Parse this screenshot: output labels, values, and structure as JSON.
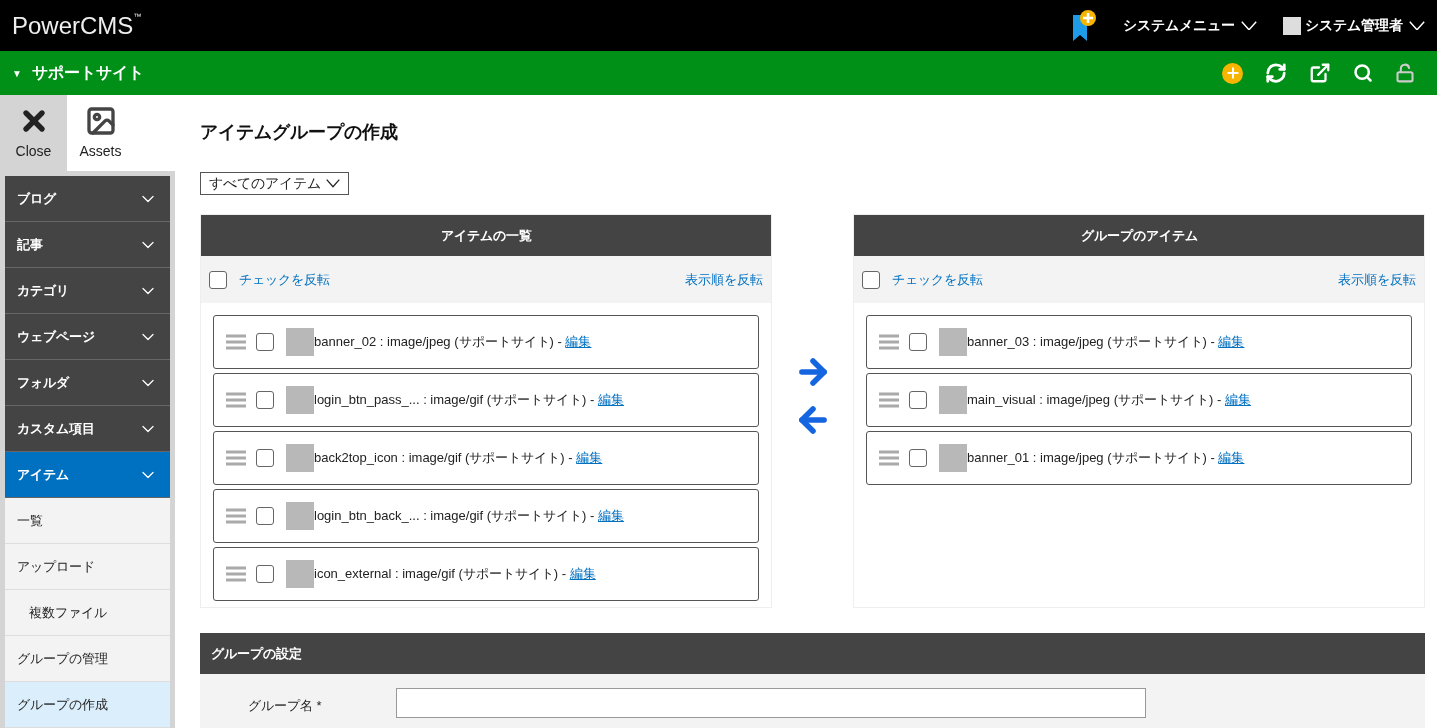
{
  "header": {
    "logo": "PowerCMS",
    "trademark": "™",
    "system_menu": "システムメニュー",
    "user": "システム管理者"
  },
  "site_bar": {
    "caret": "▼",
    "site_name": "サポートサイト"
  },
  "side_tools": [
    {
      "label": "Close",
      "kind": "close",
      "selected": true
    },
    {
      "label": "Assets",
      "kind": "assets",
      "selected": false
    }
  ],
  "sidebar": {
    "sections": [
      {
        "label": "ブログ",
        "selected": false
      },
      {
        "label": "記事",
        "selected": false
      },
      {
        "label": "カテゴリ",
        "selected": false
      },
      {
        "label": "ウェブページ",
        "selected": false
      },
      {
        "label": "フォルダ",
        "selected": false
      },
      {
        "label": "カスタム項目",
        "selected": false
      },
      {
        "label": "アイテム",
        "selected": true
      }
    ],
    "items": [
      {
        "label": "一覧",
        "selected": false
      },
      {
        "label": "アップロード",
        "selected": false,
        "children": [
          {
            "label": "複数ファイル",
            "selected": false
          }
        ]
      },
      {
        "label": "グループの管理",
        "selected": false
      },
      {
        "label": "グループの作成",
        "selected": true
      }
    ]
  },
  "page_title": "アイテムグループの作成",
  "filter": {
    "value": "すべてのアイテム"
  },
  "panels": [
    {
      "title": "アイテムの一覧",
      "invert_check": "チェックを反転",
      "reverse_order": "表示順を反転",
      "select_all": false,
      "items": [
        {
          "text": "banner_02 : image/jpeg (サポートサイト) - ",
          "link": "編集",
          "checked": false
        },
        {
          "text": "login_btn_pass_... : image/gif (サポートサイト) - ",
          "link": "編集",
          "checked": false
        },
        {
          "text": "back2top_icon : image/gif (サポートサイト) - ",
          "link": "編集",
          "checked": false
        },
        {
          "text": "login_btn_back_... : image/gif (サポートサイト) - ",
          "link": "編集",
          "checked": false
        },
        {
          "text": "icon_external : image/gif (サポートサイト) - ",
          "link": "編集",
          "checked": false
        }
      ]
    },
    {
      "title": "グループのアイテム",
      "invert_check": "チェックを反転",
      "reverse_order": "表示順を反転",
      "select_all": false,
      "items": [
        {
          "text": "banner_03 : image/jpeg (サポートサイト) - ",
          "link": "編集",
          "checked": false
        },
        {
          "text": "main_visual : image/jpeg (サポートサイト) - ",
          "link": "編集",
          "checked": false
        },
        {
          "text": "banner_01 : image/jpeg (サポートサイト) - ",
          "link": "編集",
          "checked": false
        }
      ]
    }
  ],
  "settings": {
    "title": "グループの設定",
    "fields": [
      {
        "label": "グループ名 *"
      }
    ]
  }
}
